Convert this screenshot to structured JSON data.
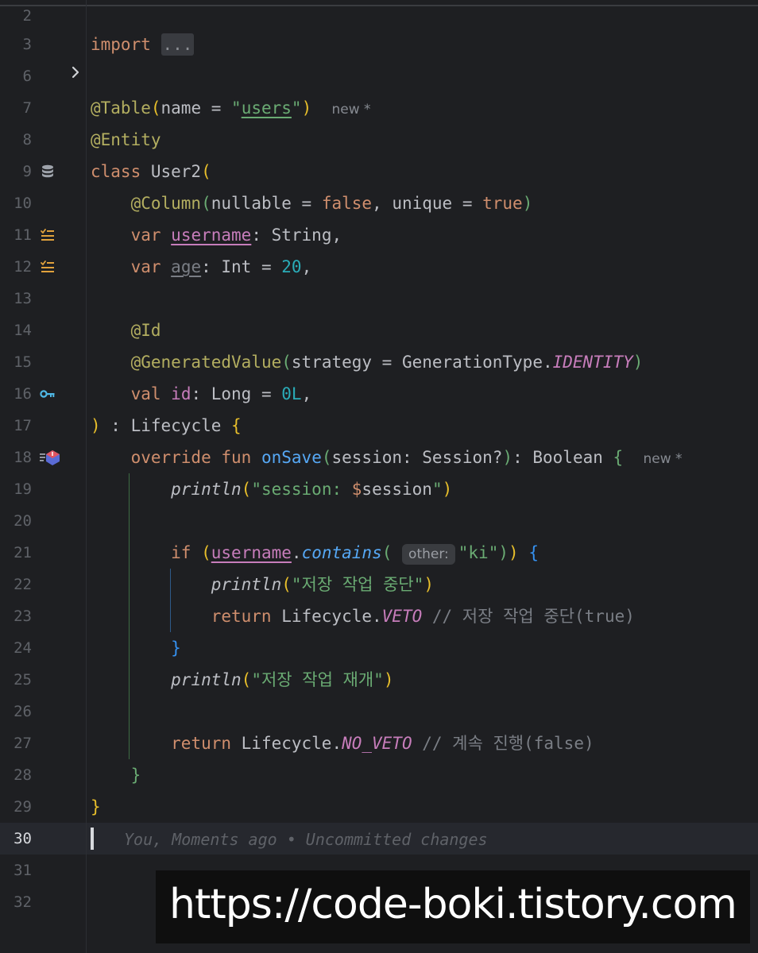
{
  "editor": {
    "blame": "You, Moments ago • Uncommitted changes",
    "current_line": "30"
  },
  "hints": {
    "new_label": "new *",
    "param_label": "other:"
  },
  "line_numbers": [
    "2",
    "3",
    "6",
    "7",
    "8",
    "9",
    "10",
    "11",
    "12",
    "13",
    "14",
    "15",
    "16",
    "17",
    "18",
    "19",
    "20",
    "21",
    "22",
    "23",
    "24",
    "25",
    "26",
    "27",
    "28",
    "29",
    "30",
    "31",
    "32"
  ],
  "code": {
    "l3": {
      "kw": "import",
      "folded": "..."
    },
    "l7": {
      "ann": "@Table",
      "open": "(",
      "arg": "name = ",
      "q1": "\"",
      "val": "users",
      "q2": "\"",
      "close": ")"
    },
    "l8": {
      "ann": "@Entity"
    },
    "l9": {
      "kw": "class",
      "rest": " User2",
      "open": "("
    },
    "l10": {
      "ann": "@Column",
      "open": "(",
      "a1": "nullable = ",
      "v1": "false",
      "mid": ", unique = ",
      "v2": "true",
      "close": ")"
    },
    "l11": {
      "kw": "var",
      "name": "username",
      "rest": ": String,"
    },
    "l12": {
      "kw": "var",
      "name": "age",
      "rest": ": Int = ",
      "num": "20",
      "tail": ","
    },
    "l14": {
      "ann": "@Id"
    },
    "l15": {
      "ann": "@GeneratedValue",
      "open": "(",
      "arg": "strategy = GenerationType.",
      "const": "IDENTITY",
      "close": ")"
    },
    "l16": {
      "kw": "val",
      "name": "id",
      "rest": ": Long = ",
      "num": "0L",
      "tail": ","
    },
    "l17": {
      "close": ")",
      "rest": " : Lifecycle ",
      "open": "{"
    },
    "l18": {
      "kw1": "override",
      "kw2": "fun",
      "fn": "onSave",
      "open": "(",
      "args": "session: Session?",
      "close": ")",
      "rest": ": Boolean ",
      "brace": "{"
    },
    "l19": {
      "fn": "println",
      "open": "(",
      "str": "\"session: ",
      "tpl": "$",
      "var": "session",
      "str2": "\"",
      "close": ")"
    },
    "l21": {
      "kw": "if",
      "open": "(",
      "name": "username",
      "dot": ".",
      "fn": "contains",
      "open2": "(",
      "str": "\"ki\"",
      "close2": ")",
      "close": ")",
      "brace": "{"
    },
    "l22": {
      "fn": "println",
      "open": "(",
      "str": "\"저장 작업 중단\"",
      "close": ")"
    },
    "l23": {
      "kw": "return",
      "rest": " Lifecycle.",
      "const": "VETO",
      "cmt": " // 저장 작업 중단(true)"
    },
    "l24": {
      "brace": "}"
    },
    "l25": {
      "fn": "println",
      "open": "(",
      "str": "\"저장 작업 재개\"",
      "close": ")"
    },
    "l27": {
      "kw": "return",
      "rest": " Lifecycle.",
      "const": "NO_VETO",
      "cmt": " // 계속 진행(false)"
    },
    "l28": {
      "brace": "}"
    },
    "l29": {
      "brace": "}"
    }
  },
  "watermark": {
    "text": "https://code-boki.tistory.com"
  }
}
